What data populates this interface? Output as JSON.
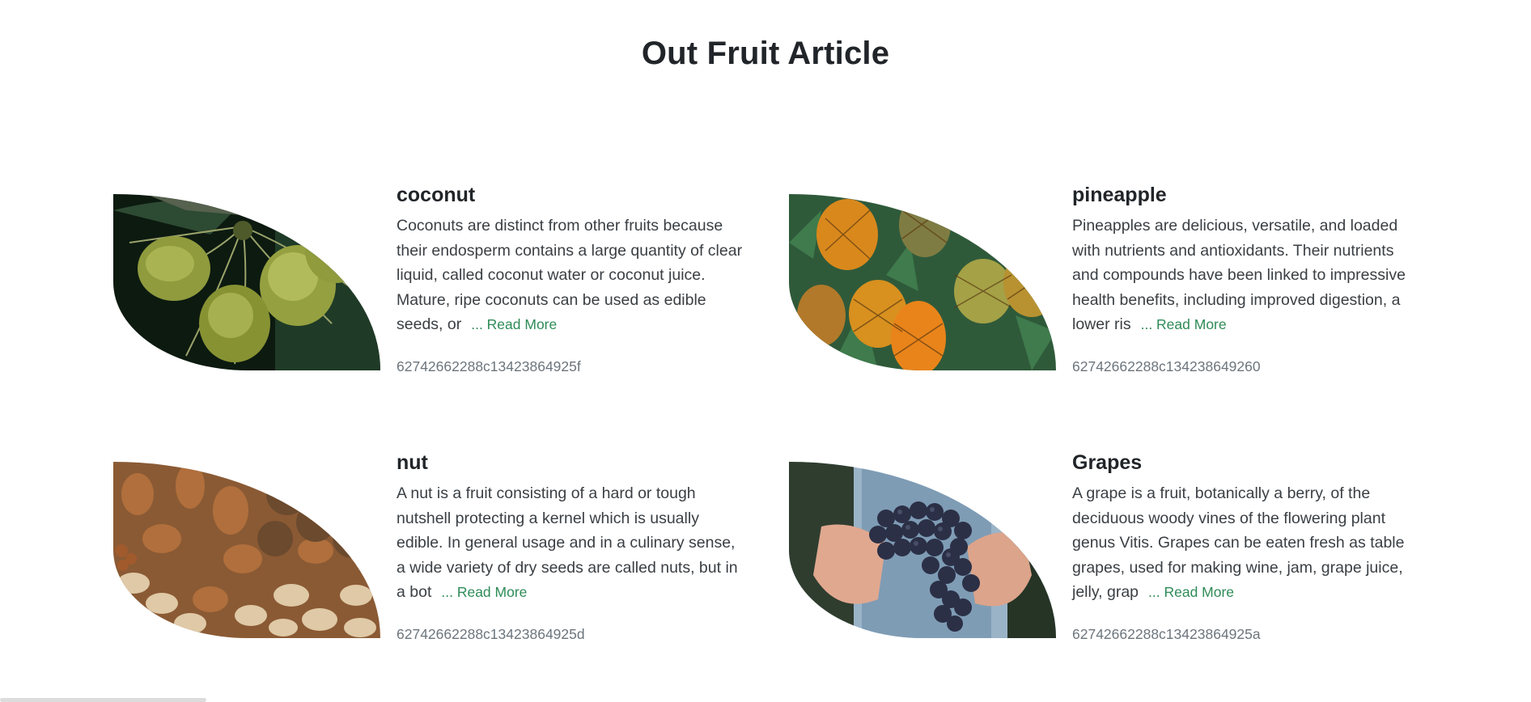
{
  "page": {
    "title": "Out Fruit Article"
  },
  "articles": [
    {
      "title": "coconut",
      "text": "Coconuts are distinct from other fruits because their endosperm contains a large quantity of clear liquid, called coconut water or coconut juice. Mature, ripe coconuts can be used as edible seeds, or",
      "read_more": "... Read More",
      "id": "62742662288c13423864925f",
      "image_icon": "coconut-photo"
    },
    {
      "title": "pineapple",
      "text": "Pineapples are delicious, versatile, and loaded with nutrients and antioxidants. Their nutrients and compounds have been linked to impressive health benefits, including improved digestion, a lower ris",
      "read_more": "... Read More",
      "id": "62742662288c134238649260",
      "image_icon": "pineapple-photo"
    },
    {
      "title": "nut",
      "text": "A nut is a fruit consisting of a hard or tough nutshell protecting a kernel which is usually edible. In general usage and in a culinary sense, a wide variety of dry seeds are called nuts, but in a bot",
      "read_more": "... Read More",
      "id": "62742662288c13423864925d",
      "image_icon": "nuts-photo"
    },
    {
      "title": "Grapes",
      "text": "A grape is a fruit, botanically a berry, of the deciduous woody vines of the flowering plant genus Vitis. Grapes can be eaten fresh as table grapes, used for making wine, jam, grape juice, jelly, grap",
      "read_more": "... Read More",
      "id": "62742662288c13423864925a",
      "image_icon": "grapes-photo"
    }
  ],
  "colors": {
    "accent_link": "#2e8b57",
    "muted": "#6c757d",
    "heading": "#212529"
  }
}
